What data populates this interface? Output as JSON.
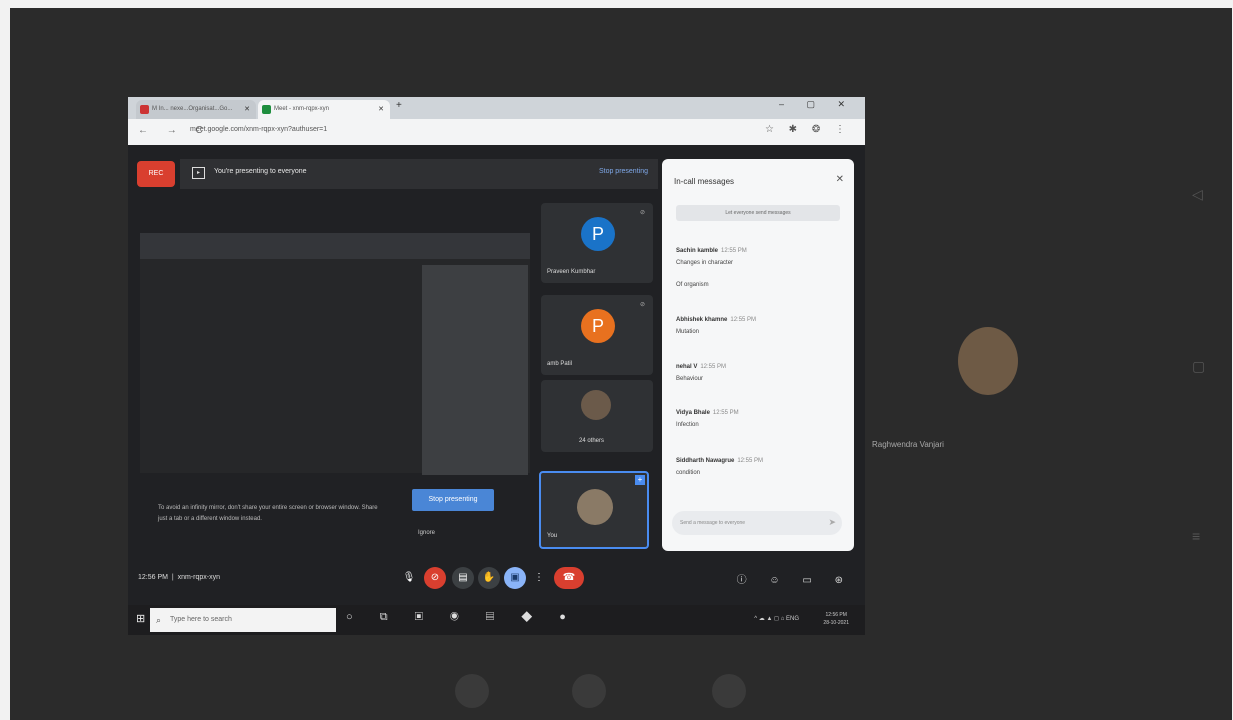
{
  "browser": {
    "tabs": [
      {
        "label": "M  In... nexe...Organisat...Go..."
      },
      {
        "label": "Meet - xnm-rqpx-xyn"
      }
    ],
    "new_tab": "+",
    "window_controls": "– ▢ ✕",
    "nav": "← → C",
    "url": "meet.google.com/xnm-rqpx-xyn?authuser=1",
    "addr_icons": "☆ ✱ ❂ ⋮"
  },
  "meet": {
    "rec_label": "REC",
    "presenting_text": "You're presenting to everyone",
    "stop_presenting_link": "Stop presenting",
    "tip_text": "To avoid an infinity mirror, don't share your entire screen or browser window. Share just a tab or a different window instead.",
    "stop_presenting_button": "Stop presenting",
    "ignore_label": "Ignore",
    "tiles": [
      {
        "initial": "P",
        "name": "Praveen Kumbhar"
      },
      {
        "initial": "P",
        "name": "amb Patil"
      },
      {
        "initial": "",
        "name": "24 others"
      },
      {
        "initial": "",
        "name": "You"
      }
    ],
    "time": "12:56 PM",
    "meeting_code": "xnm-rqpx-xyn",
    "controls": [
      "mic",
      "camera-off",
      "captions",
      "raise-hand",
      "present",
      "more",
      "end-call"
    ],
    "right_controls": "ⓘ ☺ ▭ ⊛"
  },
  "chat": {
    "title": "In-call messages",
    "close": "✕",
    "toggle_label": "Let everyone send messages",
    "messages": [
      {
        "sender": "Sachin kamble",
        "time": "12:55 PM",
        "text": "Changes in character"
      },
      {
        "sender": "",
        "time": "",
        "text": "Of organism"
      },
      {
        "sender": "Abhishek khamne",
        "time": "12:55 PM",
        "text": "Mutation"
      },
      {
        "sender": "nehal V",
        "time": "12:55 PM",
        "text": "Behaviour"
      },
      {
        "sender": "Vidya Bhale",
        "time": "12:55 PM",
        "text": "Infection"
      },
      {
        "sender": "Siddharth Nawagrue",
        "time": "12:55 PM",
        "text": "condition"
      }
    ],
    "input_placeholder": "Send a message to everyone",
    "send_icon": "➤"
  },
  "remote": {
    "name": "Raghwendra Vanjari"
  },
  "taskbar": {
    "start": "⊞",
    "search_placeholder": "Type here to search",
    "icons": "○ ⧉ ▣ ◉ ▤ ◆ ●",
    "tray": "^ ☁ ▲ ◻ ⌂ ENG",
    "clock_time": "12:56 PM",
    "clock_date": "28-10-2021"
  }
}
